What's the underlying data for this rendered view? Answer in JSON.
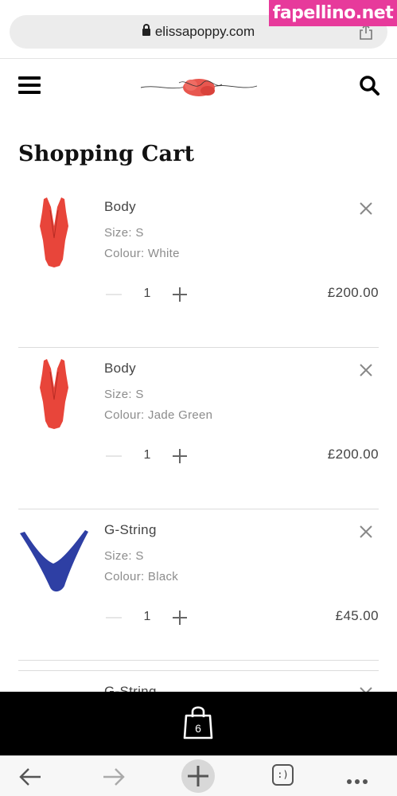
{
  "browser": {
    "url": "elissapoppy.com",
    "watermark": "fapellino.net",
    "tabs_label": ":)"
  },
  "site": {
    "logo_text": "elissa",
    "page_title": "Shopping Cart"
  },
  "cart": {
    "items": [
      {
        "name": "Body",
        "size": "Size: S",
        "colour": "Colour: White",
        "quantity": "1",
        "price": "£200.00",
        "thumb": "red-bodysuit"
      },
      {
        "name": "Body",
        "size": "Size: S",
        "colour": "Colour: Jade Green",
        "quantity": "1",
        "price": "£200.00",
        "thumb": "red-bodysuit"
      },
      {
        "name": "G-String",
        "size": "Size: S",
        "colour": "Colour: Black",
        "quantity": "1",
        "price": "£45.00",
        "thumb": "blue-gstring"
      },
      {
        "name": "G-String",
        "thumb": "blue-gstring"
      }
    ],
    "bag_count": "6"
  },
  "colors": {
    "accent_red": "#e8453a",
    "gstring_blue": "#2e3fa4",
    "watermark_pink": "#e73a9b"
  }
}
